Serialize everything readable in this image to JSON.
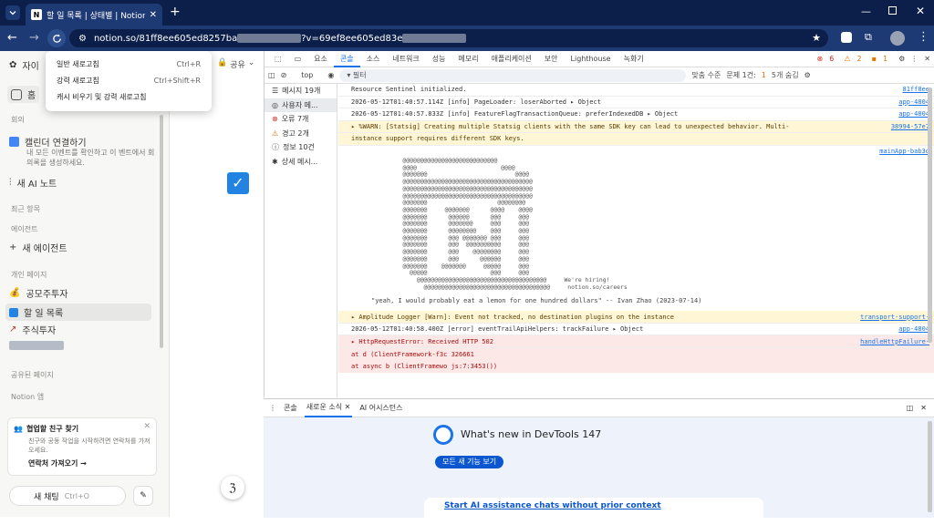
{
  "browser": {
    "tab_title": "할 일 목록 | 상태별 | Notion",
    "tab_icon": "N",
    "url_prefix": "notion.so/81ff8ee605ed8257ba",
    "url_suffix": "?v=69ef8ee605ed83e"
  },
  "context_menu": {
    "items": [
      {
        "label": "일반 새로고침",
        "shortcut": "Ctrl+R"
      },
      {
        "label": "강력 새로고침",
        "shortcut": "Ctrl+Shift+R"
      },
      {
        "label": "캐시 비우기 및 강력 새로고침",
        "shortcut": ""
      }
    ]
  },
  "sidebar": {
    "workspace": "자이",
    "home": "홈",
    "meeting_section": "회의",
    "calendar_title": "캘린더 연결하기",
    "calendar_desc": "내 모든 이벤트를 확인하고 이 벤트에서 회의록을 생성하세요.",
    "ai_note": "새 AI 노트",
    "recent_section": "최근 항목",
    "agent_section": "에이전트",
    "new_agent": "새 에이전트",
    "private_section": "개인 페이지",
    "pages": [
      "공모주투자",
      "할 일 목록",
      "주식투자"
    ],
    "shared_section": "공유된 페이지",
    "notion_app": "Notion 앱",
    "invite_title": "협업할 친구 찾기",
    "invite_desc": "친구와 공동 작업을 시작하려면 연락처를 가져오세요.",
    "invite_link": "연락처 가져오기 →",
    "new_chat": "새 채팅",
    "new_chat_shortcut": "Ctrl+O",
    "share_btn": "공유"
  },
  "devtools": {
    "tabs": [
      "요소",
      "콘솔",
      "소스",
      "네트워크",
      "성능",
      "메모리",
      "애플리케이션",
      "보안",
      "Lighthouse",
      "녹화기"
    ],
    "badges": {
      "errors": "6",
      "warnings": "2",
      "info": "1"
    },
    "toolbar": {
      "context": "top",
      "filter_placeholder": "필터",
      "level": "맞춤 수준",
      "issues": "문제 1건:",
      "issue_count": "1",
      "hidden": "5개 숨김"
    },
    "side": [
      {
        "label": "메시지 19개",
        "icon": "list-icon"
      },
      {
        "label": "사용자 메...",
        "icon": "user-icon"
      },
      {
        "label": "오류 7개",
        "icon": "error-icon"
      },
      {
        "label": "경고 2개",
        "icon": "warning-icon"
      },
      {
        "label": "정보 10건",
        "icon": "info-icon"
      },
      {
        "label": "상세 메시...",
        "icon": "bug-icon"
      }
    ],
    "logs": [
      {
        "type": "log",
        "text": "Resource Sentinel initialized.",
        "src": "81ff8ee"
      },
      {
        "type": "log",
        "text": "2026-05-12T01:40:57.114Z [info] PageLoader: loserAborted ▸ Object",
        "src": "app-4804"
      },
      {
        "type": "log",
        "text": "2026-05-12T01:40:57.833Z [info] FeatureFlagTransactionQueue: preferIndexedDB ▸ Object",
        "src": "app-4804"
      },
      {
        "type": "warn",
        "text": "▸ %WARN: [Statsig] Creating multiple Statsig clients with the same SDK key can lead to unexpected behavior. Multi-",
        "src": "38994-57e7"
      },
      {
        "type": "warn",
        "text": "instance support requires different SDK keys.",
        "src": ""
      },
      {
        "type": "log",
        "text": "",
        "src": "mainApp-bab3d"
      }
    ],
    "ascii_art": "          @@@@@@@@@@@@@@@@@@@@@@@@@@@\n          @@@@                        @@@@\n          @@@@@@@                         @@@@\n          @@@@@@@@@@@@@@@@@@@@@@@@@@@@@@@@@@@@@\n          @@@@@@@@@@@@@@@@@@@@@@@@@@@@@@@@@@@@@\n          @@@@@@@@@@@@@@@@@@@@@@@@@@@@@@@@@@@@@\n          @@@@@@@                    @@@@@@@@\n          @@@@@@@     @@@@@@@      @@@@    @@@@\n          @@@@@@@      @@@@@@      @@@     @@@\n          @@@@@@@      @@@@@@@     @@@     @@@\n          @@@@@@@      @@@@@@@@    @@@     @@@\n          @@@@@@@      @@@ @@@@@@@ @@@     @@@\n          @@@@@@@      @@@  @@@@@@@@@@     @@@\n          @@@@@@@      @@@    @@@@@@@@     @@@\n          @@@@@@@      @@@      @@@@@@     @@@\n          @@@@@@@    @@@@@@@     @@@@@     @@@\n            @@@@@                  @@@     @@@\n              @@@@@@@@@@@@@@@@@@@@@@@@@@@@@@@@@@@@@     We're hiring!\n                @@@@@@@@@@@@@@@@@@@@@@@@@@@@@@@@@@@@     notion.so/careers",
    "quote": "\"yeah, I would probably eat a lemon for one hundred dollars\" -- Ivan Zhao (2023-07-14)",
    "logs2": [
      {
        "type": "warn",
        "text": "▸ Amplitude Logger [Warn]: Event not tracked, no destination plugins on the instance",
        "src": "transport-support-"
      },
      {
        "type": "log",
        "text": "2026-05-12T01:40:58.400Z [error] eventTrailApiHelpers: trackFailure ▸ Object",
        "src": "app-4804"
      },
      {
        "type": "err",
        "text": "▸ HttpRequestError: Received HTTP 502",
        "src": "handleHttpFailure-"
      },
      {
        "type": "err",
        "text": "    at d (ClientFramework-f3c          326661",
        "src": ""
      },
      {
        "type": "err",
        "text": "    at async b (ClientFramewo                 js:7:3453())",
        "src": ""
      }
    ]
  },
  "drawer": {
    "tabs": [
      "콘솔",
      "새로운 소식",
      "AI 어시스턴스"
    ],
    "headline": "What's new in DevTools 147",
    "button": "모든 새 기능 보기",
    "card_title": "Start AI assistance chats without prior context"
  },
  "colors": {
    "tabbar": "#0b1f4a",
    "addrbar": "#1e3a74",
    "accent": "#1a73e8"
  }
}
